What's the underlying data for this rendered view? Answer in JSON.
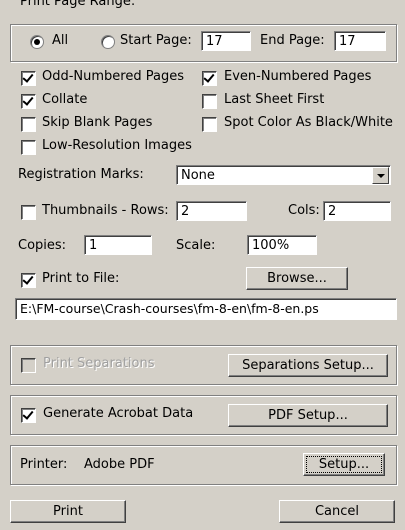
{
  "page_range": {
    "group_label": "Print Page Range:",
    "all_label": "All",
    "all_selected": true,
    "start_label": "Start Page:",
    "start_value": "17",
    "end_label": "End Page:",
    "end_value": "17"
  },
  "options": {
    "odd_pages": "Odd-Numbered Pages",
    "even_pages": "Even-Numbered Pages",
    "collate": "Collate",
    "last_sheet_first": "Last Sheet First",
    "skip_blank": "Skip Blank Pages",
    "spot_color": "Spot Color As Black/White",
    "low_res": "Low-Resolution Images"
  },
  "registration": {
    "label": "Registration Marks:",
    "value": "None"
  },
  "thumbnails": {
    "label": "Thumbnails - Rows:",
    "rows": "2",
    "cols_label": "Cols:",
    "cols": "2"
  },
  "copies": {
    "label": "Copies:",
    "value": "1",
    "scale_label": "Scale:",
    "scale_value": "100%"
  },
  "print_to_file": {
    "label": "Print to File:",
    "browse_label": "Browse...",
    "path": "E:\\FM-course\\Crash-courses\\fm-8-en\\fm-8-en.ps"
  },
  "separations": {
    "label": "Print Separations",
    "setup_label": "Separations Setup..."
  },
  "acrobat": {
    "label": "Generate Acrobat Data",
    "setup_label": "PDF Setup..."
  },
  "printer": {
    "label": "Printer:",
    "name": "Adobe PDF",
    "setup_label": "Setup..."
  },
  "actions": {
    "print_label": "Print",
    "cancel_label": "Cancel"
  }
}
